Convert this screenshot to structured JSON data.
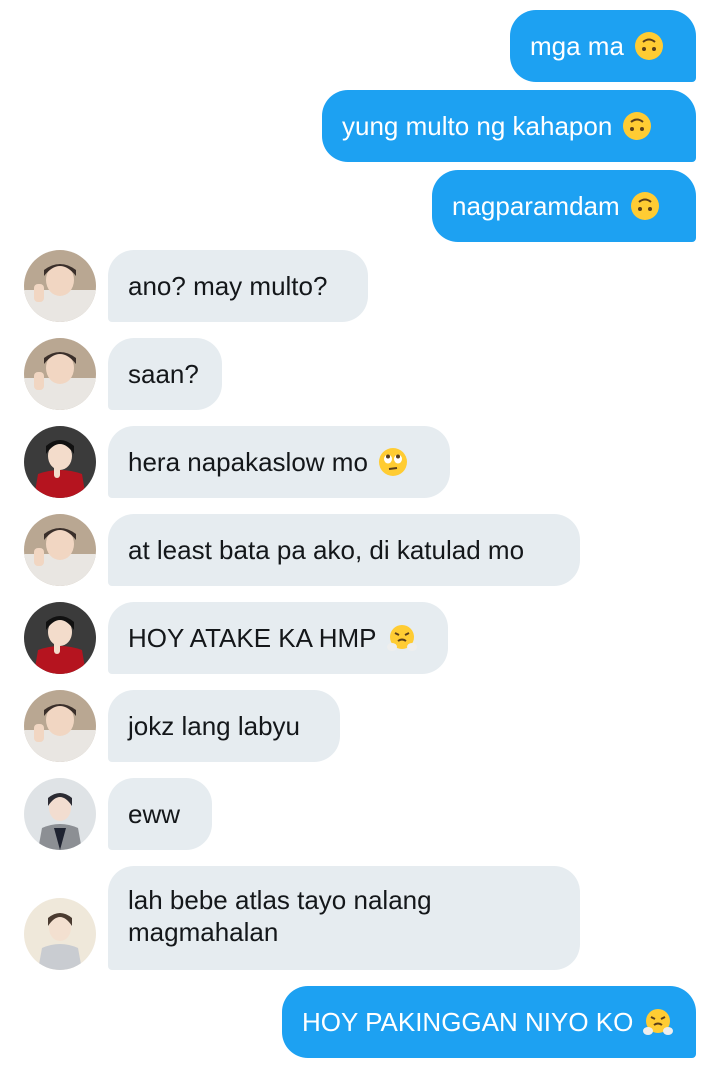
{
  "messages": [
    {
      "text": "mga ma",
      "emoji": "upside-down-face-emoji"
    },
    {
      "text": "yung multo ng kahapon",
      "emoji": "upside-down-face-emoji"
    },
    {
      "text": "nagparamdam",
      "emoji": "upside-down-face-emoji"
    },
    {
      "text": "ano? may multo?",
      "avatar": "avatar-user-a"
    },
    {
      "text": "saan?",
      "avatar": "avatar-user-a"
    },
    {
      "text": "hera napakaslow mo",
      "emoji": "eye-roll-emoji",
      "avatar": "avatar-user-b"
    },
    {
      "text": "at least bata pa ako, di katulad mo",
      "avatar": "avatar-user-a"
    },
    {
      "text": "HOY ATAKE KA HMP",
      "emoji": "steam-from-nose-emoji",
      "avatar": "avatar-user-b"
    },
    {
      "text": "jokz lang labyu",
      "avatar": "avatar-user-a"
    },
    {
      "text": "eww",
      "avatar": "avatar-user-c"
    },
    {
      "text": "lah bebe atlas tayo nalang magmahalan",
      "avatar": "avatar-user-d"
    },
    {
      "text": "HOY PAKINGGAN NIYO KO",
      "emoji": "steam-from-nose-emoji"
    }
  ],
  "colors": {
    "sent_bubble": "#1da1f2",
    "received_bubble": "#e6ecf0",
    "sent_text": "#ffffff",
    "received_text": "#14171a"
  }
}
